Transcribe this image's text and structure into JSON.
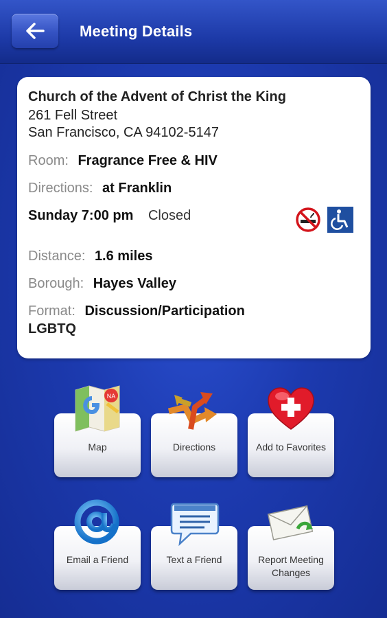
{
  "header": {
    "title": "Meeting Details",
    "back_icon": "arrow-left-icon"
  },
  "meeting": {
    "name": "Church of the Advent of Christ the King",
    "address_line1": "261 Fell Street",
    "address_line2": "San Francisco, CA 94102-5147",
    "room_label": "Room:",
    "room_value": "Fragrance Free & HIV",
    "directions_label": "Directions:",
    "directions_value": "at Franklin",
    "day_time": "Sunday 7:00 pm",
    "type": "Closed",
    "feature_icons": [
      "no-smoking-icon",
      "wheelchair-accessible-icon"
    ],
    "distance_label": "Distance:",
    "distance_value": "1.6 miles",
    "borough_label": "Borough:",
    "borough_value": "Hayes Valley",
    "format_label": "Format:",
    "format_value": "Discussion/Participation",
    "format_value2": "LGBTQ"
  },
  "actions": {
    "map": "Map",
    "directions": "Directions",
    "favorites": "Add to Favorites",
    "email": "Email a Friend",
    "text": "Text a Friend",
    "report_line1": "Report Meeting",
    "report_line2": "Changes"
  },
  "colors": {
    "background": "#1c3aaf",
    "header": "#1d3aa8",
    "card": "#ffffff",
    "label": "#8a8a8a"
  }
}
